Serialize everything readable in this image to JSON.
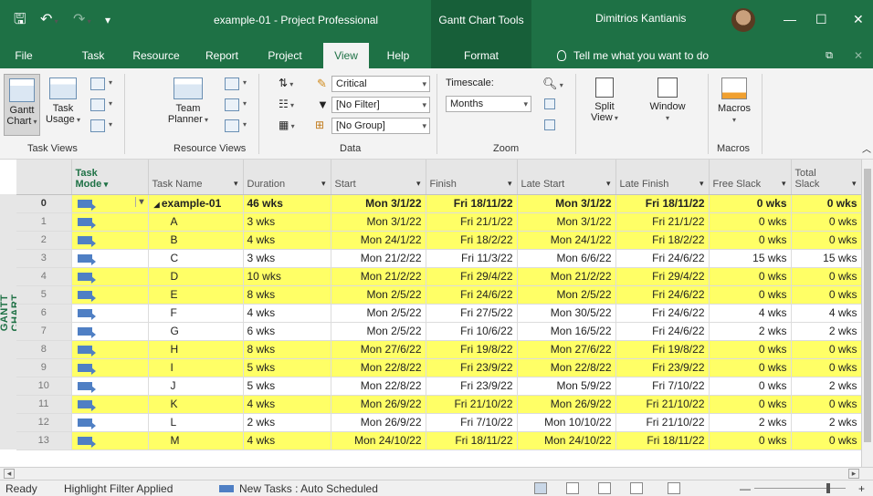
{
  "titlebar": {
    "save_icon": "save-icon",
    "undo_icon": "undo-icon",
    "redo_icon": "redo-icon",
    "title": "example-01 - Project Professional",
    "contextual_tab_group": "Gantt Chart Tools",
    "user_name": "Dimitrios Kantianis",
    "minimize_icon": "—",
    "maximize_icon": "☐",
    "close_icon": "✕"
  },
  "tabs": {
    "file": "File",
    "task": "Task",
    "resource": "Resource",
    "report": "Report",
    "project": "Project",
    "view": "View",
    "help": "Help",
    "format": "Format",
    "tell_me": "Tell me what you want to do"
  },
  "ribbon": {
    "gantt_chart": "Gantt",
    "gantt_chart2": "Chart",
    "task_usage": "Task",
    "task_usage2": "Usage",
    "team_planner": "Team",
    "team_planner2": "Planner",
    "task_views_label": "Task Views",
    "resource_views_label": "Resource Views",
    "highlight_value": "Critical",
    "filter_value": "[No Filter]",
    "group_value": "[No Group]",
    "data_label": "Data",
    "timescale_label": "Timescale:",
    "timescale_value": "Months",
    "zoom_label": "Zoom",
    "split_view": "Split",
    "split_view2": "View",
    "window": "Window",
    "macros": "Macros",
    "macros_label": "Macros"
  },
  "sideband_label": "GANTT CHART",
  "columns": {
    "mode": "Task Mode",
    "mode_line1": "Task",
    "mode_line2": "Mode",
    "name": "Task Name",
    "duration": "Duration",
    "start": "Start",
    "finish": "Finish",
    "late_start": "Late Start",
    "late_finish": "Late Finish",
    "free_slack": "Free Slack",
    "total_slack_line1": "Total",
    "total_slack_line2": "Slack"
  },
  "rows": [
    {
      "id": "0",
      "name": "example-01",
      "duration": "46 wks",
      "start": "Mon 3/1/22",
      "finish": "Fri 18/11/22",
      "late_start": "Mon 3/1/22",
      "late_finish": "Fri 18/11/22",
      "free_slack": "0 wks",
      "total_slack": "0 wks"
    },
    {
      "id": "1",
      "name": "A",
      "duration": "3 wks",
      "start": "Mon 3/1/22",
      "finish": "Fri 21/1/22",
      "late_start": "Mon 3/1/22",
      "late_finish": "Fri 21/1/22",
      "free_slack": "0 wks",
      "total_slack": "0 wks"
    },
    {
      "id": "2",
      "name": "B",
      "duration": "4 wks",
      "start": "Mon 24/1/22",
      "finish": "Fri 18/2/22",
      "late_start": "Mon 24/1/22",
      "late_finish": "Fri 18/2/22",
      "free_slack": "0 wks",
      "total_slack": "0 wks"
    },
    {
      "id": "3",
      "name": "C",
      "duration": "3 wks",
      "start": "Mon 21/2/22",
      "finish": "Fri 11/3/22",
      "late_start": "Mon 6/6/22",
      "late_finish": "Fri 24/6/22",
      "free_slack": "15 wks",
      "total_slack": "15 wks"
    },
    {
      "id": "4",
      "name": "D",
      "duration": "10 wks",
      "start": "Mon 21/2/22",
      "finish": "Fri 29/4/22",
      "late_start": "Mon 21/2/22",
      "late_finish": "Fri 29/4/22",
      "free_slack": "0 wks",
      "total_slack": "0 wks"
    },
    {
      "id": "5",
      "name": "E",
      "duration": "8 wks",
      "start": "Mon 2/5/22",
      "finish": "Fri 24/6/22",
      "late_start": "Mon 2/5/22",
      "late_finish": "Fri 24/6/22",
      "free_slack": "0 wks",
      "total_slack": "0 wks"
    },
    {
      "id": "6",
      "name": "F",
      "duration": "4 wks",
      "start": "Mon 2/5/22",
      "finish": "Fri 27/5/22",
      "late_start": "Mon 30/5/22",
      "late_finish": "Fri 24/6/22",
      "free_slack": "4 wks",
      "total_slack": "4 wks"
    },
    {
      "id": "7",
      "name": "G",
      "duration": "6 wks",
      "start": "Mon 2/5/22",
      "finish": "Fri 10/6/22",
      "late_start": "Mon 16/5/22",
      "late_finish": "Fri 24/6/22",
      "free_slack": "2 wks",
      "total_slack": "2 wks"
    },
    {
      "id": "8",
      "name": "H",
      "duration": "8 wks",
      "start": "Mon 27/6/22",
      "finish": "Fri 19/8/22",
      "late_start": "Mon 27/6/22",
      "late_finish": "Fri 19/8/22",
      "free_slack": "0 wks",
      "total_slack": "0 wks"
    },
    {
      "id": "9",
      "name": "I",
      "duration": "5 wks",
      "start": "Mon 22/8/22",
      "finish": "Fri 23/9/22",
      "late_start": "Mon 22/8/22",
      "late_finish": "Fri 23/9/22",
      "free_slack": "0 wks",
      "total_slack": "0 wks"
    },
    {
      "id": "10",
      "name": "J",
      "duration": "5 wks",
      "start": "Mon 22/8/22",
      "finish": "Fri 23/9/22",
      "late_start": "Mon 5/9/22",
      "late_finish": "Fri 7/10/22",
      "free_slack": "0 wks",
      "total_slack": "2 wks"
    },
    {
      "id": "11",
      "name": "K",
      "duration": "4 wks",
      "start": "Mon 26/9/22",
      "finish": "Fri 21/10/22",
      "late_start": "Mon 26/9/22",
      "late_finish": "Fri 21/10/22",
      "free_slack": "0 wks",
      "total_slack": "0 wks"
    },
    {
      "id": "12",
      "name": "L",
      "duration": "2 wks",
      "start": "Mon 26/9/22",
      "finish": "Fri 7/10/22",
      "late_start": "Mon 10/10/22",
      "late_finish": "Fri 21/10/22",
      "free_slack": "2 wks",
      "total_slack": "2 wks"
    },
    {
      "id": "13",
      "name": "M",
      "duration": "4 wks",
      "start": "Mon 24/10/22",
      "finish": "Fri 18/11/22",
      "late_start": "Mon 24/10/22",
      "late_finish": "Fri 18/11/22",
      "free_slack": "0 wks",
      "total_slack": "0 wks"
    }
  ],
  "highlighted_rows": [
    "0",
    "1",
    "2",
    "4",
    "5",
    "8",
    "9",
    "11",
    "13"
  ],
  "colors": {
    "brand": "#1e7145",
    "highlight": "#ffff66",
    "mode_icon": "#4f7fc4"
  },
  "status": {
    "ready": "Ready",
    "filter": "Highlight Filter Applied",
    "new_tasks": "New Tasks : Auto Scheduled"
  }
}
